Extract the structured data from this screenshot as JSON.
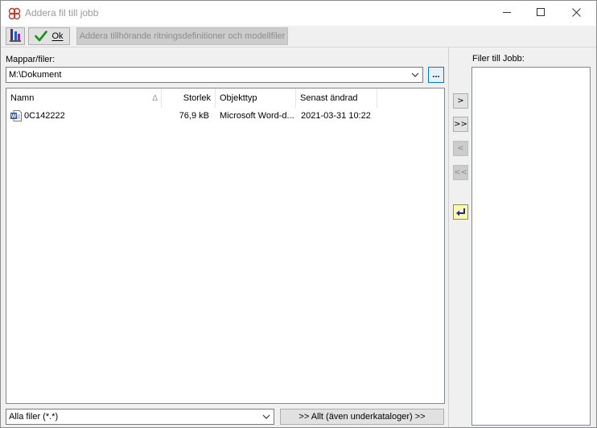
{
  "window": {
    "title": "Addera fil till jobb",
    "controls": {
      "minimize": "minimize-icon",
      "maximize": "maximize-icon",
      "close": "close-icon"
    }
  },
  "toolbar": {
    "ok_label": "Ok",
    "ok_mnemonic": "O",
    "add_related_label": "Addera tillhörande ritningsdefinitioner och modellfiler"
  },
  "left": {
    "folders_label": "Mappar/filer:",
    "path_value": "M:\\Dokument",
    "browse_label": "...",
    "columns": [
      "Namn",
      "Storlek",
      "Objekttyp",
      "Senast ändrad"
    ],
    "sort_indicator": "Δ",
    "files": [
      {
        "name": "0C142222",
        "size": "76,9 kB",
        "type": "Microsoft Word-d...",
        "modified": "2021-03-31 10:22",
        "icon": "word-document-icon"
      }
    ],
    "filter_value": "Alla filer (*.*)",
    "all_button_label": ">> Allt (även underkataloger) >>"
  },
  "transfer": {
    "add_one": ">",
    "add_all": ">>",
    "remove_one": "<",
    "remove_all": "<<",
    "return_icon": "return-arrow-icon"
  },
  "right": {
    "label": "Filer till Jobb:"
  },
  "colors": {
    "accent": "#0078d7",
    "title_inactive": "#9a9a9a",
    "ok_check": "#1a8f1a"
  }
}
